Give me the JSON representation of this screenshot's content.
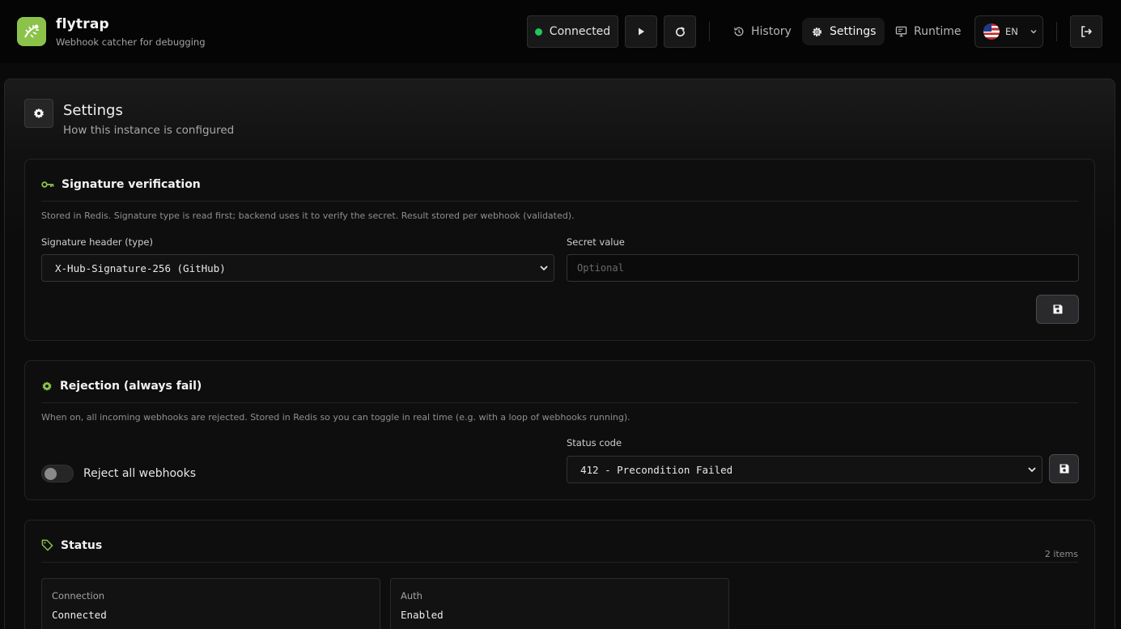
{
  "app": {
    "name": "flytrap",
    "tagline": "Webhook catcher for debugging"
  },
  "header": {
    "connection_label": "Connected",
    "nav": {
      "history": "History",
      "settings": "Settings",
      "runtime": "Runtime"
    },
    "language": "EN"
  },
  "page": {
    "title": "Settings",
    "subtitle": "How this instance is configured"
  },
  "signature": {
    "title": "Signature verification",
    "description": "Stored in Redis. Signature type is read first; backend uses it to verify the secret. Result stored per webhook (validated).",
    "header_label": "Signature header (type)",
    "header_value": "X-Hub-Signature-256 (GitHub)",
    "secret_label": "Secret value",
    "secret_placeholder": "Optional"
  },
  "rejection": {
    "title": "Rejection (always fail)",
    "description": "When on, all incoming webhooks are rejected. Stored in Redis so you can toggle in real time (e.g. with a loop of webhooks running).",
    "toggle_label": "Reject all webhooks",
    "toggle_on": false,
    "status_label": "Status code",
    "status_value": "412 - Precondition Failed"
  },
  "status": {
    "title": "Status",
    "count": "2 items",
    "items": [
      {
        "label": "Connection",
        "value": "Connected"
      },
      {
        "label": "Auth",
        "value": "Enabled"
      }
    ]
  },
  "colors": {
    "accent": "#8bc34a",
    "connected": "#22c55e"
  },
  "icons": [
    "flytrap-logo-icon",
    "play-icon",
    "refresh-icon",
    "history-icon",
    "gear-icon",
    "monitor-icon",
    "us-flag-icon",
    "chevron-down-icon",
    "logout-icon",
    "key-icon",
    "save-icon",
    "tag-icon"
  ]
}
